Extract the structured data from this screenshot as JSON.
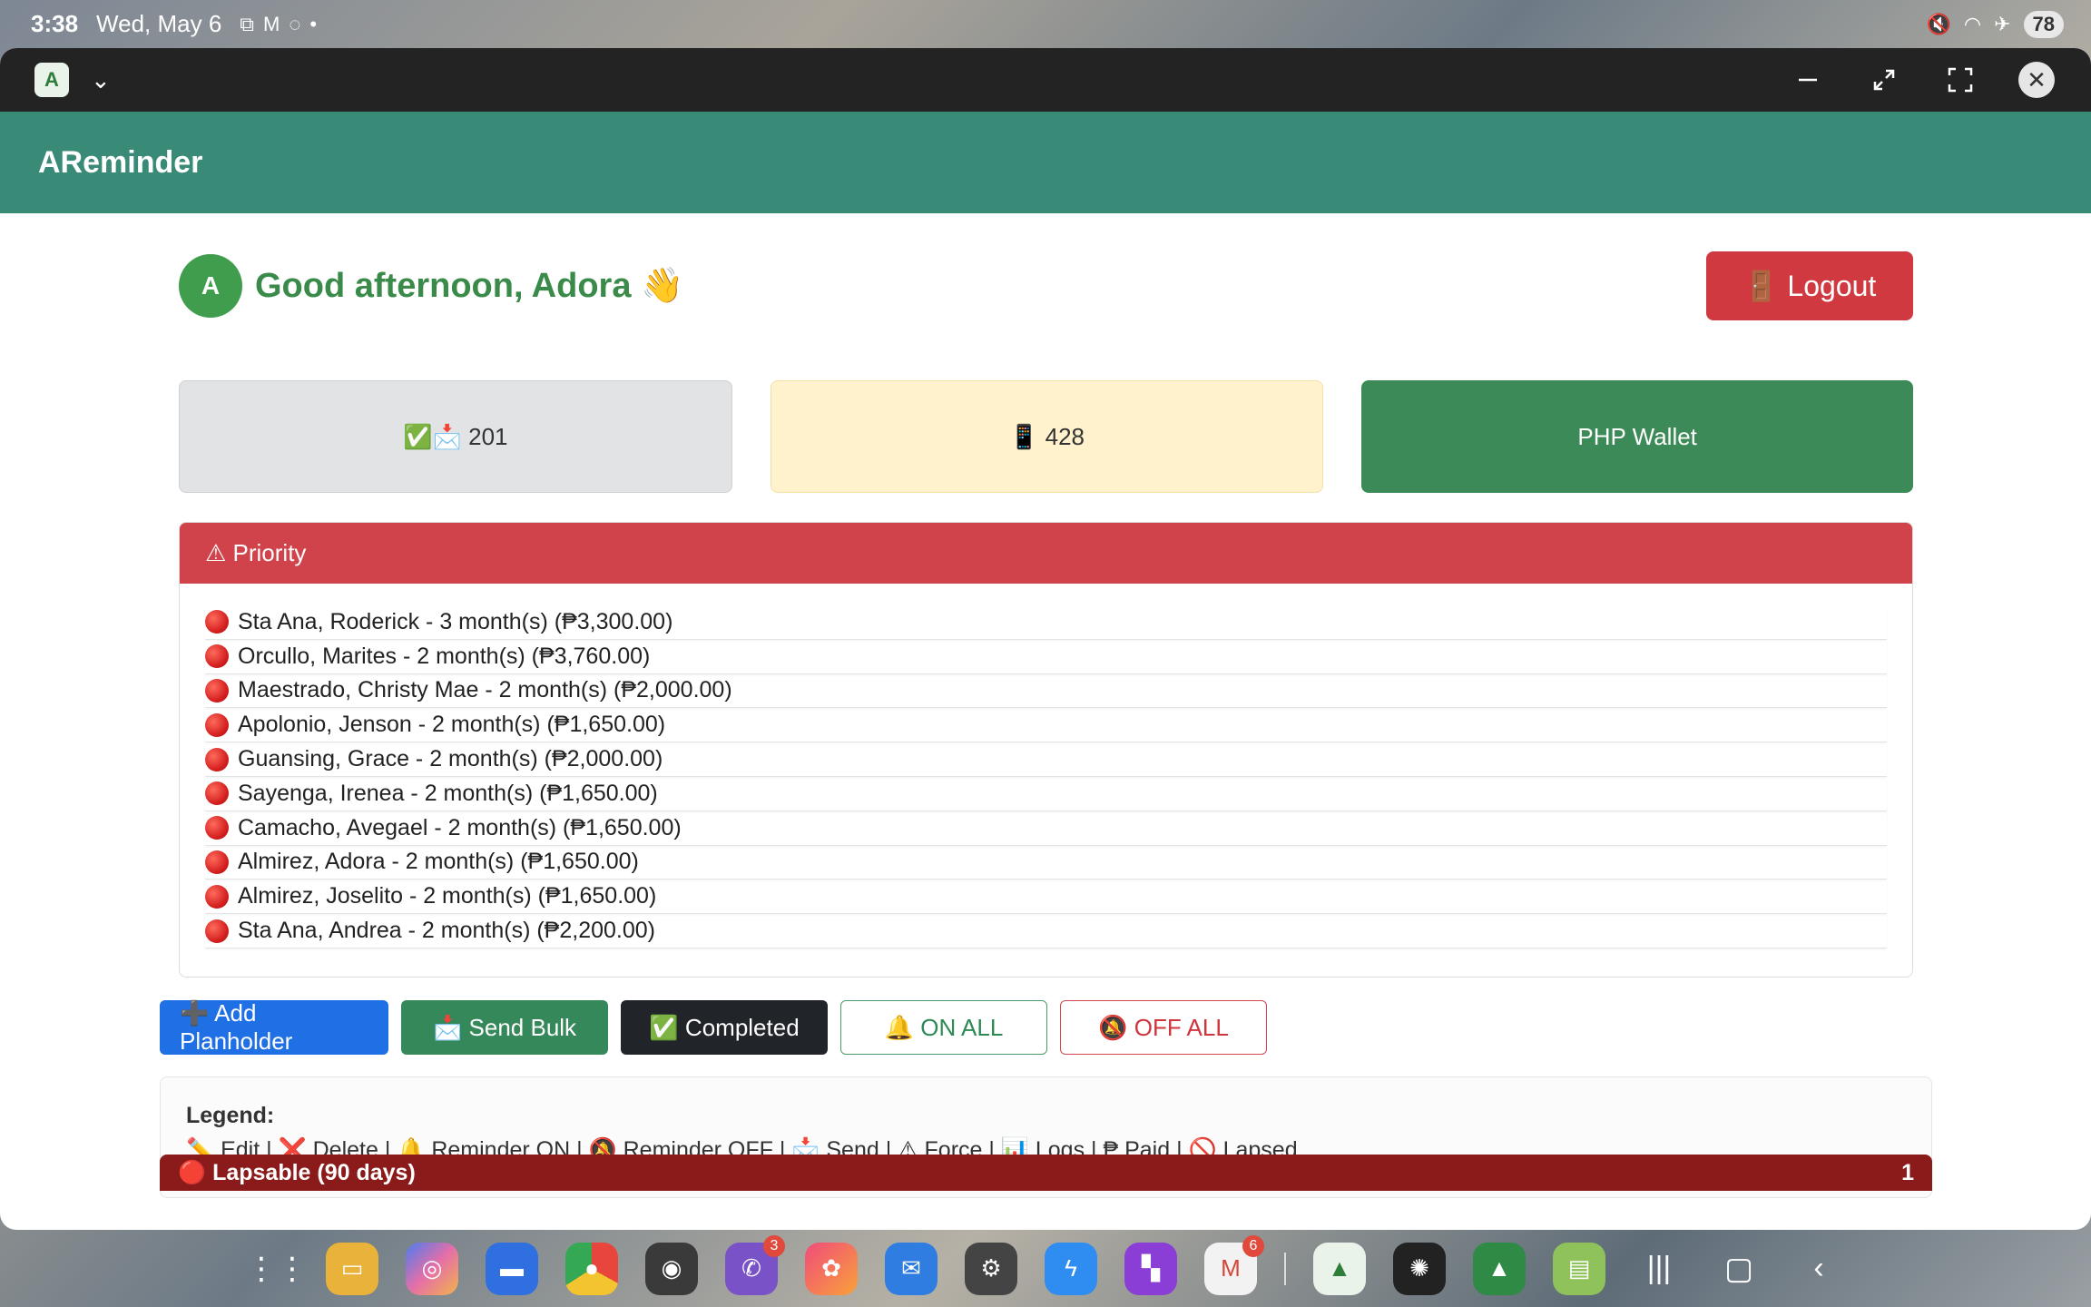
{
  "status_bar": {
    "time": "3:38",
    "date": "Wed, May 6",
    "battery": "78"
  },
  "window": {
    "app_icon_letter": "A"
  },
  "app": {
    "title": "AReminder"
  },
  "greeting": {
    "avatar_letter": "A",
    "text": "Good afternoon, Adora 👋",
    "logout_label": "🚪 Logout"
  },
  "cards": {
    "sent": "✅📩 201",
    "sms": "📱 428",
    "wallet": "PHP Wallet"
  },
  "priority": {
    "title": "⚠ Priority",
    "items": [
      "Sta Ana, Roderick - 3 month(s) (₱3,300.00)",
      "Orcullo, Marites - 2 month(s) (₱3,760.00)",
      "Maestrado, Christy Mae - 2 month(s) (₱2,000.00)",
      "Apolonio, Jenson - 2 month(s) (₱1,650.00)",
      "Guansing, Grace - 2 month(s) (₱2,000.00)",
      "Sayenga, Irenea - 2 month(s) (₱1,650.00)",
      "Camacho, Avegael - 2 month(s) (₱1,650.00)",
      "Almirez, Adora - 2 month(s) (₱1,650.00)",
      "Almirez, Joselito - 2 month(s) (₱1,650.00)",
      "Sta Ana, Andrea - 2 month(s) (₱2,200.00)"
    ]
  },
  "actions": {
    "add": "➕ Add Planholder",
    "bulk": "📩 Send Bulk",
    "completed": "✅ Completed",
    "on_all": "🔔 ON ALL",
    "off_all": "🔕 OFF ALL"
  },
  "legend": {
    "title": "Legend:",
    "items": "✏️ Edit | ❌ Delete | 🔔 Reminder ON | 🔕 Reminder OFF | 📩 Send | ⚠ Force | 📊 Logs | ₱ Paid | 🚫 Lapsed"
  },
  "lapsable": {
    "title": "🔴 Lapsable (90 days)",
    "count": "1"
  },
  "taskbar": {
    "badges": {
      "viber": "3",
      "gmail": "6"
    }
  }
}
